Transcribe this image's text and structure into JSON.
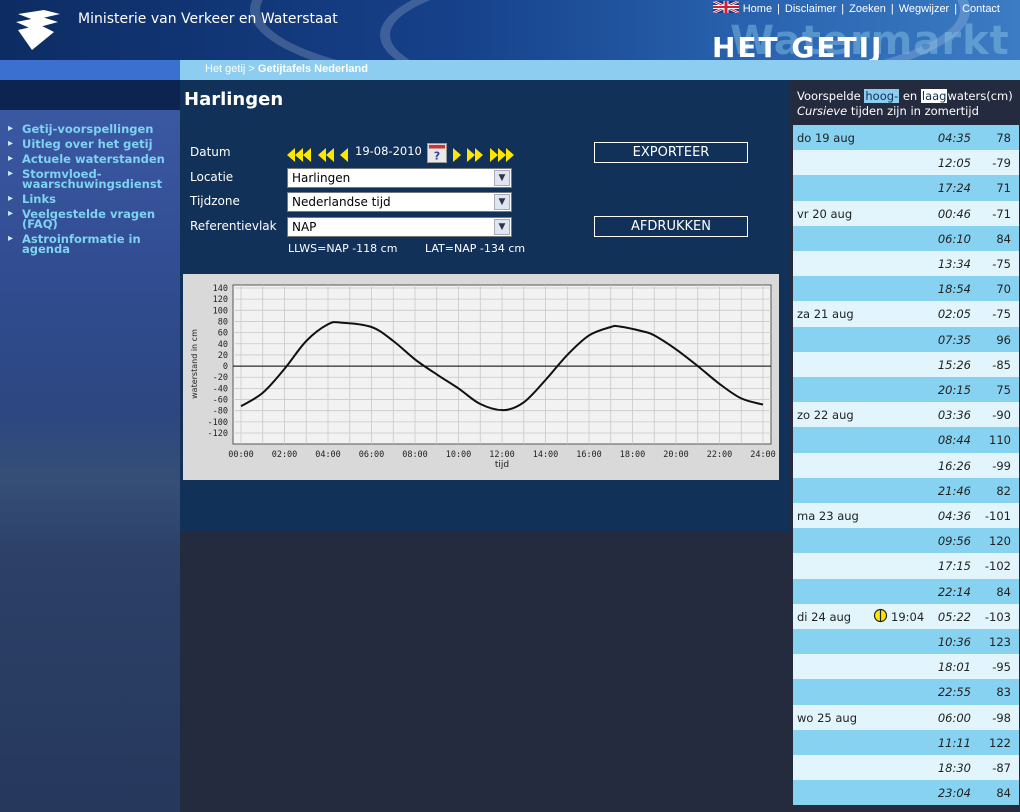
{
  "header": {
    "ministry": "Ministerie van Verkeer en Waterstaat",
    "links": [
      "Home",
      "Disclaimer",
      "Zoeken",
      "Wegwijzer",
      "Contact"
    ],
    "brand": "HET GETIJ",
    "brand_ghost": "Watermarkt"
  },
  "breadcrumb": {
    "home": "Het getij",
    "sep": ">",
    "current": "Getijtafels Nederland"
  },
  "sidebar": {
    "items": [
      "Getij-voorspellingen",
      "Uitleg over het getij",
      "Actuele waterstanden",
      "Stormvloed-waarschuwingsdienst",
      "Links",
      "Veelgestelde vragen (FAQ)",
      "Astroinformatie in agenda"
    ]
  },
  "main": {
    "title": "Harlingen",
    "date_label": "Datum",
    "date_value": "19-08-2010",
    "location_label": "Locatie",
    "location_value": "Harlingen",
    "timezone_label": "Tijdzone",
    "timezone_value": "Nederlandse tijd",
    "reference_label": "Referentievlak",
    "reference_value": "NAP",
    "export_button": "EXPORTEER",
    "print_button": "AFDRUKKEN",
    "llws": "LLWS=NAP -118 cm",
    "lat": "LAT=NAP -134 cm"
  },
  "tides": {
    "header_pre": "Voorspelde ",
    "header_hoog": "hoog-",
    "header_mid": " en ",
    "header_laag": "laag",
    "header_post": "waters(cm)",
    "note_italic": "Cursieve",
    "note_rest": " tijden zijn in zomertijd",
    "rows": [
      {
        "day": "do 19 aug",
        "time": "04:35",
        "value": "78"
      },
      {
        "day": "",
        "time": "12:05",
        "value": "-79"
      },
      {
        "day": "",
        "time": "17:24",
        "value": "71"
      },
      {
        "day": "vr 20 aug",
        "time": "00:46",
        "value": "-71"
      },
      {
        "day": "",
        "time": "06:10",
        "value": "84"
      },
      {
        "day": "",
        "time": "13:34",
        "value": "-75"
      },
      {
        "day": "",
        "time": "18:54",
        "value": "70"
      },
      {
        "day": "za 21 aug",
        "time": "02:05",
        "value": "-75"
      },
      {
        "day": "",
        "time": "07:35",
        "value": "96"
      },
      {
        "day": "",
        "time": "15:26",
        "value": "-85"
      },
      {
        "day": "",
        "time": "20:15",
        "value": "75"
      },
      {
        "day": "zo 22 aug",
        "time": "03:36",
        "value": "-90"
      },
      {
        "day": "",
        "time": "08:44",
        "value": "110"
      },
      {
        "day": "",
        "time": "16:26",
        "value": "-99"
      },
      {
        "day": "",
        "time": "21:46",
        "value": "82"
      },
      {
        "day": "ma 23 aug",
        "time": "04:36",
        "value": "-101"
      },
      {
        "day": "",
        "time": "09:56",
        "value": "120"
      },
      {
        "day": "",
        "time": "17:15",
        "value": "-102"
      },
      {
        "day": "",
        "time": "22:14",
        "value": "84"
      },
      {
        "day": "di 24 aug",
        "moon_time": "19:04",
        "time": "05:22",
        "value": "-103"
      },
      {
        "day": "",
        "time": "10:36",
        "value": "123"
      },
      {
        "day": "",
        "time": "18:01",
        "value": "-95"
      },
      {
        "day": "",
        "time": "22:55",
        "value": "83"
      },
      {
        "day": "wo 25 aug",
        "time": "06:00",
        "value": "-98"
      },
      {
        "day": "",
        "time": "11:11",
        "value": "122"
      },
      {
        "day": "",
        "time": "18:30",
        "value": "-87"
      },
      {
        "day": "",
        "time": "23:04",
        "value": "84"
      }
    ],
    "row_colors": [
      "#87d2f1",
      "#e2f5fc"
    ]
  },
  "chart_data": {
    "type": "line",
    "xlabel": "tijd",
    "ylabel": "waterstand in cm",
    "xlim": [
      0,
      24
    ],
    "ylim": [
      -120,
      140
    ],
    "xticks": [
      "00:00",
      "02:00",
      "04:00",
      "06:00",
      "08:00",
      "10:00",
      "12:00",
      "14:00",
      "16:00",
      "18:00",
      "20:00",
      "22:00",
      "24:00"
    ],
    "yticks": [
      140,
      120,
      100,
      80,
      60,
      40,
      20,
      0,
      -20,
      -40,
      -60,
      -80,
      -100,
      -120
    ],
    "grid": true,
    "x": [
      0,
      1,
      2,
      3,
      4,
      4.58,
      6,
      7,
      8,
      9,
      10,
      11,
      12.08,
      13,
      14,
      15,
      16,
      17,
      17.4,
      18.5,
      19,
      20,
      21,
      22,
      23,
      24
    ],
    "values": [
      -72,
      -48,
      -5,
      45,
      75,
      78,
      70,
      45,
      12,
      -15,
      -40,
      -68,
      -79,
      -65,
      -25,
      20,
      55,
      70,
      71,
      62,
      55,
      30,
      0,
      -32,
      -58,
      -69
    ]
  }
}
